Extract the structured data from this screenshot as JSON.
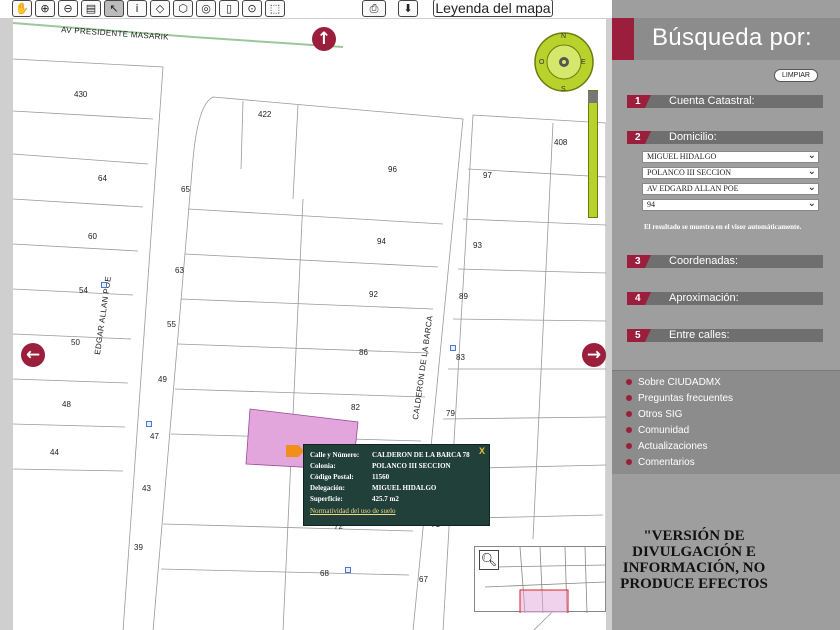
{
  "toolbar": {
    "legend_label": "Leyenda del mapa",
    "icons": [
      "hand-pan-icon",
      "zoom-in-icon",
      "zoom-out-icon",
      "measure-icon",
      "pointer-icon",
      "info-icon",
      "erase-icon",
      "shape-icon",
      "identify-icon",
      "document-icon",
      "search-area-icon",
      "select-area-icon",
      "print-icon",
      "download-icon"
    ]
  },
  "map": {
    "streets": {
      "masarik": "AV PRESIDENTE MASARIK",
      "allan_poe": "EDGAR ALLAN POE",
      "calderon": "CALDERON DE LA BARCA"
    },
    "lots": [
      "430",
      "422",
      "408",
      "96",
      "97",
      "64",
      "65",
      "94",
      "93",
      "60",
      "63",
      "54",
      "92",
      "89",
      "50",
      "55",
      "86",
      "83",
      "49",
      "48",
      "82",
      "79",
      "47",
      "44",
      "43",
      "39",
      "68",
      "67",
      "72",
      "71"
    ],
    "compass": {
      "n": "N",
      "s": "S",
      "e": "E",
      "o": "O"
    },
    "popup": {
      "close": "X",
      "street_key": "Calle y Número:",
      "street_val": "CALDERON DE LA BARCA 78",
      "colonia_key": "Colonia:",
      "colonia_val": "POLANCO III SECCION",
      "cp_key": "Código Postal:",
      "cp_val": "11560",
      "delegacion_key": "Delegación:",
      "delegacion_val": "MIGUEL HIDALGO",
      "superficie_key": "Superficie:",
      "superficie_val": "425.7 m2",
      "link": "Normatividad del uso de suelo"
    }
  },
  "sidebar": {
    "title": "Búsqueda por:",
    "limpiar": "LIMPIAR",
    "sections": [
      {
        "num": "1",
        "label": "Cuenta Catastral:"
      },
      {
        "num": "2",
        "label": "Domicilio:"
      },
      {
        "num": "3",
        "label": "Coordenadas:"
      },
      {
        "num": "4",
        "label": "Aproximación:"
      },
      {
        "num": "5",
        "label": "Entre calles:"
      }
    ],
    "domicilio_selects": [
      "MIGUEL HIDALGO",
      "POLANCO III SECCION",
      "AV EDGARD ALLAN POE",
      "94"
    ],
    "result_note": "El resultado se muestra en el visor automáticamente.",
    "links": [
      "Sobre CIUDADMX",
      "Preguntas frecuentes",
      "Otros SIG",
      "Comunidad",
      "Actualizaciones",
      "Comentarios"
    ],
    "disclaimer": "\"VERSIÓN DE DIVULGACIÓN E INFORMACIÓN, NO PRODUCE EFECTOS"
  },
  "colors": {
    "accent": "#9b1e3c",
    "parcel": "#e2a6dc",
    "popup_bg": "#22403a",
    "sidebar": "#9e9e9e"
  }
}
